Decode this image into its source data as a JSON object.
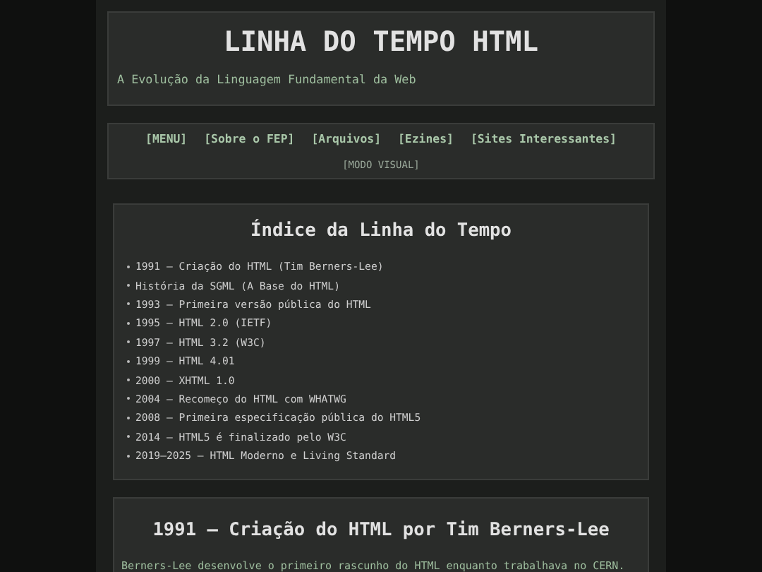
{
  "header": {
    "title": "LINHA DO TEMPO HTML",
    "subtitle": "A Evolução da Linguagem Fundamental da Web"
  },
  "nav": {
    "links": [
      "[MENU]",
      "[Sobre o FEP]",
      "[Arquivos]",
      "[Ezines]",
      "[Sites Interessantes]"
    ],
    "mode_link": "[MODO VISUAL]"
  },
  "index": {
    "title": "Índice da Linha do Tempo",
    "items": [
      "1991 — Criação do HTML (Tim Berners-Lee)",
      "História da SGML (A Base do HTML)",
      "1993 — Primeira versão pública do HTML",
      "1995 — HTML 2.0 (IETF)",
      "1997 — HTML 3.2 (W3C)",
      "1999 — HTML 4.01",
      "2000 — XHTML 1.0",
      "2004 — Recomeço do HTML com WHATWG",
      "2008 — Primeira especificação pública do HTML5",
      "2014 — HTML5 é finalizado pelo W3C",
      "2019–2025 — HTML Moderno e Living Standard"
    ]
  },
  "section": {
    "title": "1991 — Criação do HTML por Tim Berners-Lee",
    "text": "Berners-Lee desenvolve o primeiro rascunho do HTML enquanto trabalhava no CERN."
  }
}
